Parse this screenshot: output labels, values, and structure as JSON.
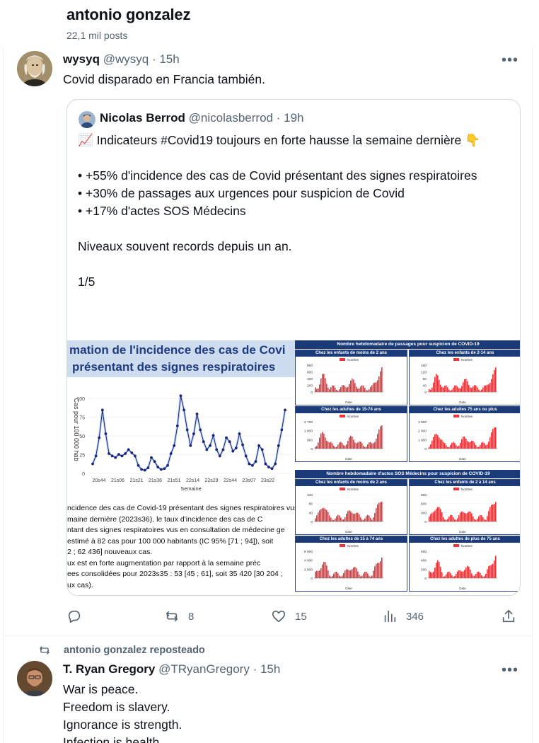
{
  "profile": {
    "name": "antonio gonzalez",
    "posts": "22,1 mil posts"
  },
  "tweet1": {
    "display_name": "wysyq",
    "handle": "@wysyq",
    "time": "· 15h",
    "text": "Covid disparado en Francia también.",
    "quote": {
      "display_name": "Nicolas Berrod",
      "handle": "@nicolasberrod",
      "time": "· 19h",
      "text": "📈 Indicateurs #Covid19 toujours en forte hausse la semaine dernière 👇\n\n• +55% d'incidence des cas de Covid présentant des signes respiratoires\n• +30% de passages aux urgences pour suspicion de Covid\n• +17% d'actes SOS Médecins\n\nNiveaux souvent records depuis un an.\n\n1/5",
      "media_left": {
        "title_line1": "mation de l'incidence des cas de Covi",
        "title_line2": "présentant des signes respiratoires",
        "ylabel": "Cas pour 100 000 hab",
        "xlabel": "Semaine",
        "yticks": [
          "100",
          "75",
          "50",
          "25",
          "0"
        ],
        "xticks": [
          "20s44",
          "21s06",
          "21s21",
          "21s36",
          "21s51",
          "22s14",
          "22s29",
          "22s44",
          "23s07",
          "23s22"
        ],
        "desc_lines": [
          "ncidence des cas de Covid-19 présentant des signes respiratoires vus en médecine générale depuis",
          "maine dernière (2023s36), le taux d'incidence des cas de C",
          "ntant des signes respiratoires vus en consultation de médecine ge",
          "estimé à 82 cas pour 100 000 habitants (IC 95% [71 ; 94]), soit",
          "2 ; 62 436] nouveaux cas.",
          "ux est en forte augmentation par rapport à la semaine préc",
          "ees consolidées pour 2023s35 : 53 [45 ; 61], soit 35 420 [30 204 ;",
          "ux cas)."
        ]
      },
      "media_right": {
        "header_top": "Nombre hebdomadaire de passages pour suspicion de COVID-19",
        "header_mid": "Nombre hebdomadaire d'actes SOS Médecins pour suspicion de COVID-19",
        "legend": "Nombre",
        "xaxis_label": "Date",
        "cells": [
          {
            "title": "Chez les enfants de moins de 2 ans",
            "yticks": [
              "800",
              "600",
              "400",
              "200",
              "0"
            ]
          },
          {
            "title": "Chez les enfants de 2-14 ans",
            "yticks": [
              "160",
              "120",
              "80",
              "40",
              "0"
            ]
          },
          {
            "title": "Chez les adultes de 15-74 ans",
            "yticks": [
              "2 700",
              "1 800",
              "900",
              "0"
            ]
          },
          {
            "title": "Chez les adultes 75 ans ou plus",
            "yticks": [
              "3 000",
              "2 000",
              "1 000",
              "0"
            ]
          },
          {
            "title": "Chez les enfants de moins de 2 ans",
            "yticks": [
              "120",
              "80",
              "40",
              "0"
            ]
          },
          {
            "title": "Chez les enfants de 2 à 14 ans",
            "yticks": [
              "900",
              "600",
              "300",
              "0"
            ]
          },
          {
            "title": "Chez les adultes de 15 à 74 ans",
            "yticks": [
              "6 000",
              "4 000",
              "2 000",
              "0"
            ]
          },
          {
            "title": "Chez les adultes de plus de 75 ans",
            "yticks": [
              "600",
              "400",
              "200",
              "0"
            ]
          }
        ]
      }
    },
    "actions": {
      "replies": "",
      "reposts": "8",
      "likes": "15",
      "views": "346"
    }
  },
  "repost_label": "antonio gonzalez reposteado",
  "tweet2": {
    "display_name": "T. Ryan Gregory",
    "handle": "@TRyanGregory",
    "time": "· 15h",
    "text": "War is peace.\nFreedom is slavery.\nIgnorance is strength.\nInfection is health."
  },
  "colors": {
    "muted": "#536471",
    "border": "#cfd9de",
    "chart_blue": "#1a237e",
    "bar_red": "#e8383b",
    "header_navy": "#1a3a78"
  },
  "icons": [
    "more-icon",
    "reply-icon",
    "repost-icon",
    "like-icon",
    "views-icon",
    "share-icon",
    "chart-emoji-icon",
    "point-down-emoji-icon"
  ]
}
